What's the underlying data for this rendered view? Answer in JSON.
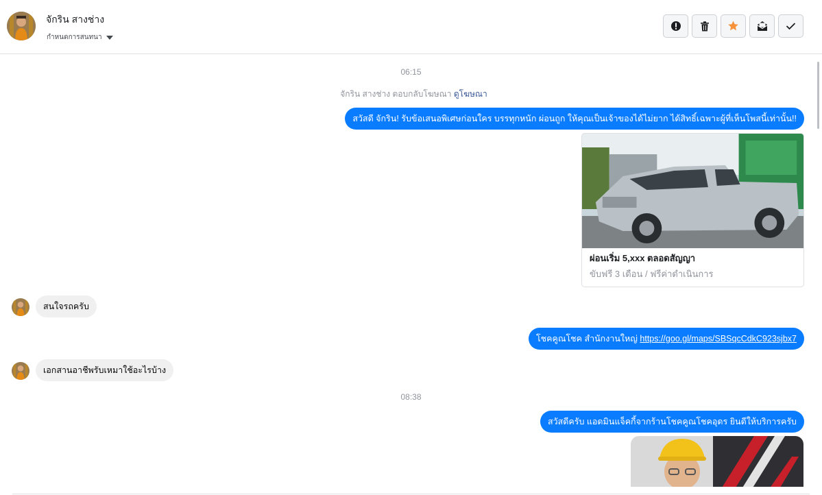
{
  "header": {
    "contact_name": "จักริน สางช่าง",
    "assign_label": "กำหนดการสนทนา",
    "actions": [
      {
        "name": "mark-spam-button",
        "icon": "alert-circle-icon"
      },
      {
        "name": "delete-button",
        "icon": "trash-icon"
      },
      {
        "name": "star-button",
        "icon": "star-icon"
      },
      {
        "name": "mark-unread-button",
        "icon": "envelope-icon"
      },
      {
        "name": "mark-done-button",
        "icon": "check-icon"
      }
    ]
  },
  "thread": {
    "time_1": "06:15",
    "ad_reply_text": "จักริน สางช่าง ตอบกลับโฆษณา",
    "ad_link": "ดูโฆษณา",
    "msg_1": "สวัสดี จักริน! รับข้อเสนอพิเศษก่อนใคร บรรทุกหนัก ผ่อนถูก ให้คุณเป็นเจ้าของได้ไม่ยาก ได้สิทธิ์เฉพาะผู้ที่เห็นโพสนี้เท่านั้น!!",
    "card_title": "ผ่อนเริ่ม 5,xxx ตลอดสัญญา",
    "card_subtitle": "ขับฟรี 3 เดือน / ฟรีค่าดำเนินการ",
    "msg_2": "สนใจรถครับ",
    "msg_3_text": "โชคคูณโชค สำนักงานใหญ่ ",
    "msg_3_link": "https://goo.gl/maps/SBSqcCdkC923sjbx7",
    "msg_4": "เอกสานอาชีพรับเหมาใช้อะไรบ้าง",
    "time_2": "08:38",
    "msg_5": "สวัสดีครับ แอดมินแจ็คกี้จากร้านโชคคูณโชคอุดร ยินดีให้บริการครับ"
  },
  "colors": {
    "outgoing_bubble": "#0a7cff",
    "incoming_bubble": "#f1f0f0",
    "star": "#f7923a",
    "link": "#385898"
  }
}
